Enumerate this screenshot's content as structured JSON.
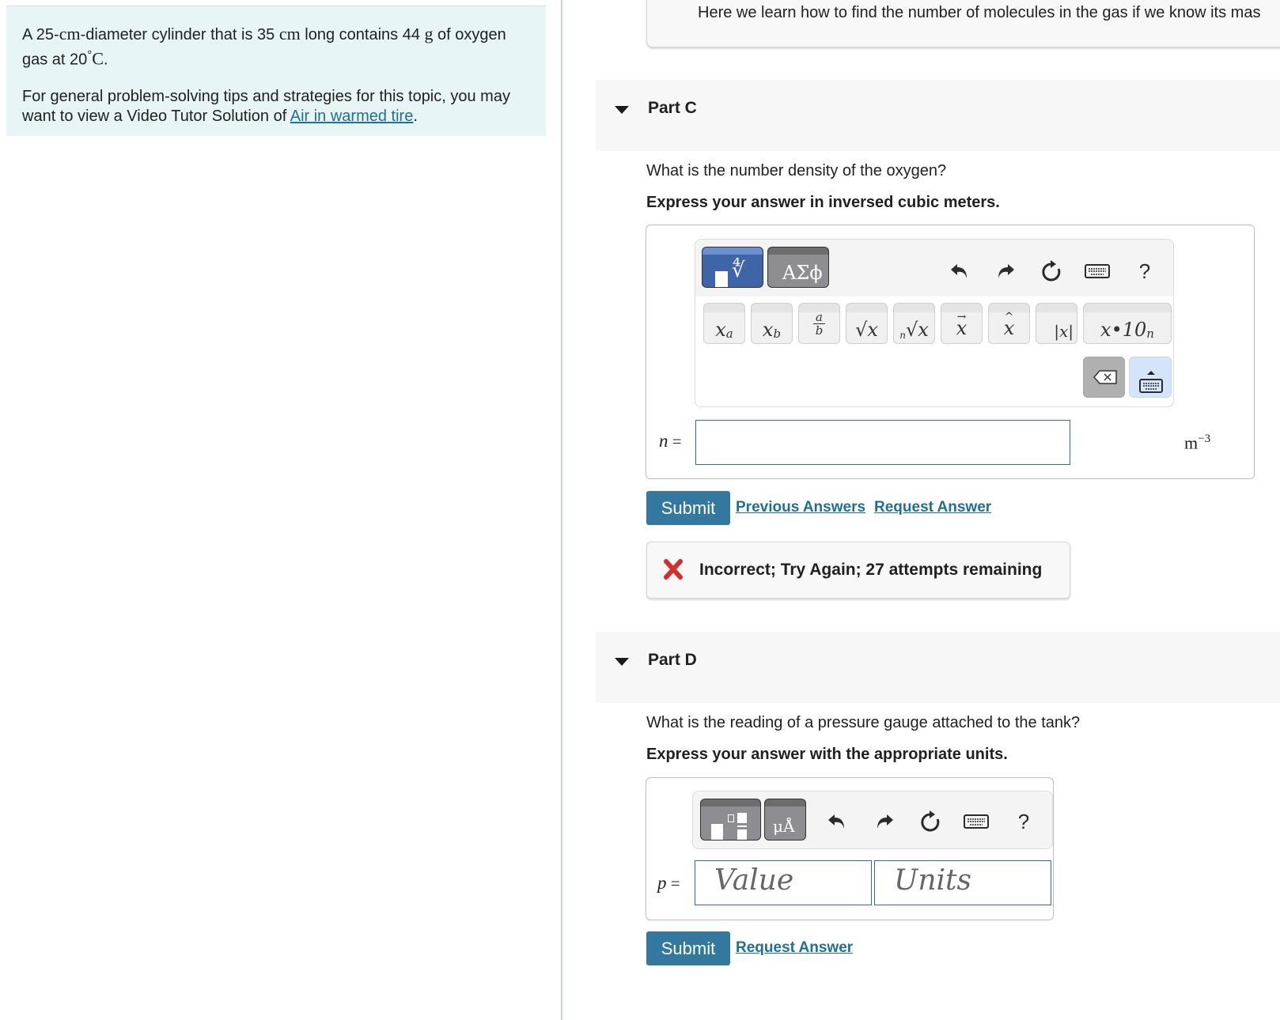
{
  "problem": {
    "statement_parts": [
      "A 25-",
      "cm",
      "-diameter cylinder that is 35 ",
      "cm",
      " long contains 44 ",
      "g",
      " of oxygen gas at 20",
      "°",
      "C",
      "."
    ],
    "tips_prefix": "For general problem-solving tips and strategies for this topic, you may want to view a Video Tutor Solution of ",
    "tips_link": "Air in warmed tire",
    "tips_suffix": "."
  },
  "hint": {
    "text": "Here we learn how to find the number of molecules in the gas if we know its mas"
  },
  "part_c": {
    "title": "Part C",
    "question": "What is the number density of the oxygen?",
    "instruction": "Express your answer in inversed cubic meters.",
    "toolbar": {
      "template_label": "templates",
      "greek_label": "ΑΣϕ",
      "help_label": "?"
    },
    "keys": [
      {
        "base": "x",
        "sup": "a"
      },
      {
        "base": "x",
        "sub": "b"
      },
      {
        "num": "a",
        "den": "b"
      },
      {
        "label": "√x"
      },
      {
        "idx": "n",
        "label": "√x"
      },
      {
        "label": "x",
        "accent": "→"
      },
      {
        "label": "x",
        "accent": "^"
      },
      {
        "label": "|x|"
      },
      {
        "label": "x•10",
        "sup": "n"
      }
    ],
    "variable": "n",
    "equals": "=",
    "input_value": "",
    "unit_base": "m",
    "unit_exp": "−3",
    "submit_label": "Submit",
    "previous_answers_label": "Previous Answers",
    "request_answer_label": "Request Answer",
    "feedback": {
      "status": "incorrect",
      "message": "Incorrect; Try Again; 27 attempts remaining",
      "color": "#d32f2f"
    }
  },
  "part_d": {
    "title": "Part D",
    "question": "What is the reading of a pressure gauge attached to the tank?",
    "instruction": "Express your answer with the appropriate units.",
    "toolbar": {
      "units_label": "μÅ",
      "help_label": "?"
    },
    "variable": "p",
    "equals": "=",
    "value_placeholder": "Value",
    "units_placeholder": "Units",
    "submit_label": "Submit",
    "request_answer_label": "Request Answer"
  },
  "colors": {
    "accent": "#33789e",
    "link": "#1f6f99",
    "intro_bg": "#e7f5f6"
  }
}
